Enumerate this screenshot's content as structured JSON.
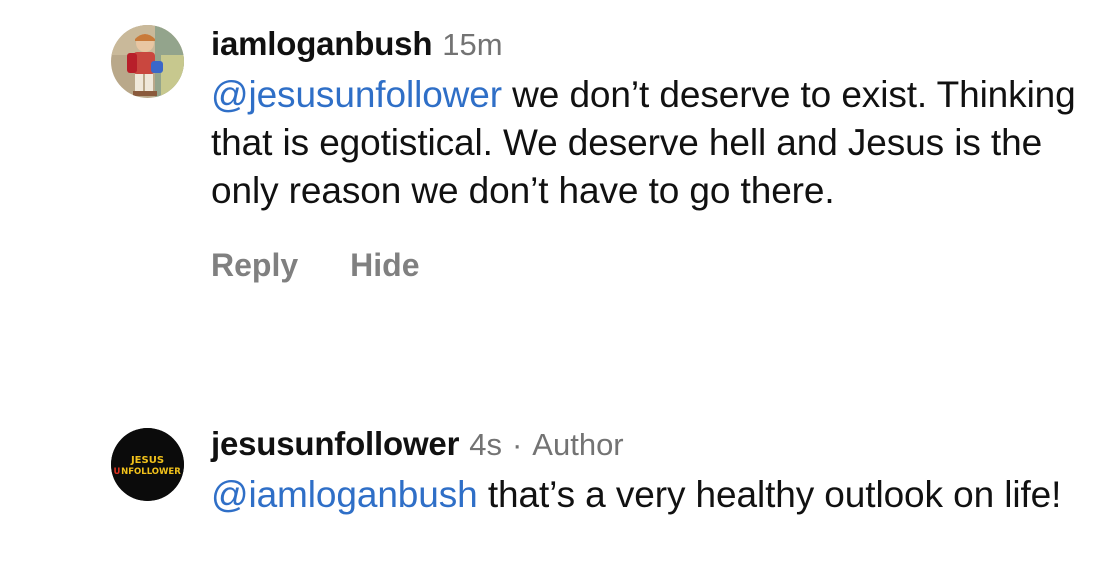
{
  "comments": [
    {
      "username": "iamloganbush",
      "time": "15m",
      "mention": "@jesusunfollower",
      "text": " we don’t deserve to exist. Thinking that is egotistical. We deserve hell and Jesus is the only reason we don’t have to go there.",
      "actions": {
        "reply": "Reply",
        "hide": "Hide"
      }
    },
    {
      "username": "jesusunfollower",
      "time": "4s",
      "separator": "·",
      "badge": "Author",
      "logo_line1": "JESUS",
      "logo_line2": "UNFOLLOWER",
      "mention": "@iamloganbush",
      "text": " that’s a very healthy outlook on life!"
    }
  ],
  "colors": {
    "mention": "#2f6fc7",
    "secondary_text": "#737373",
    "logo_yellow": "#f2c21b",
    "logo_red": "#e0301e"
  }
}
